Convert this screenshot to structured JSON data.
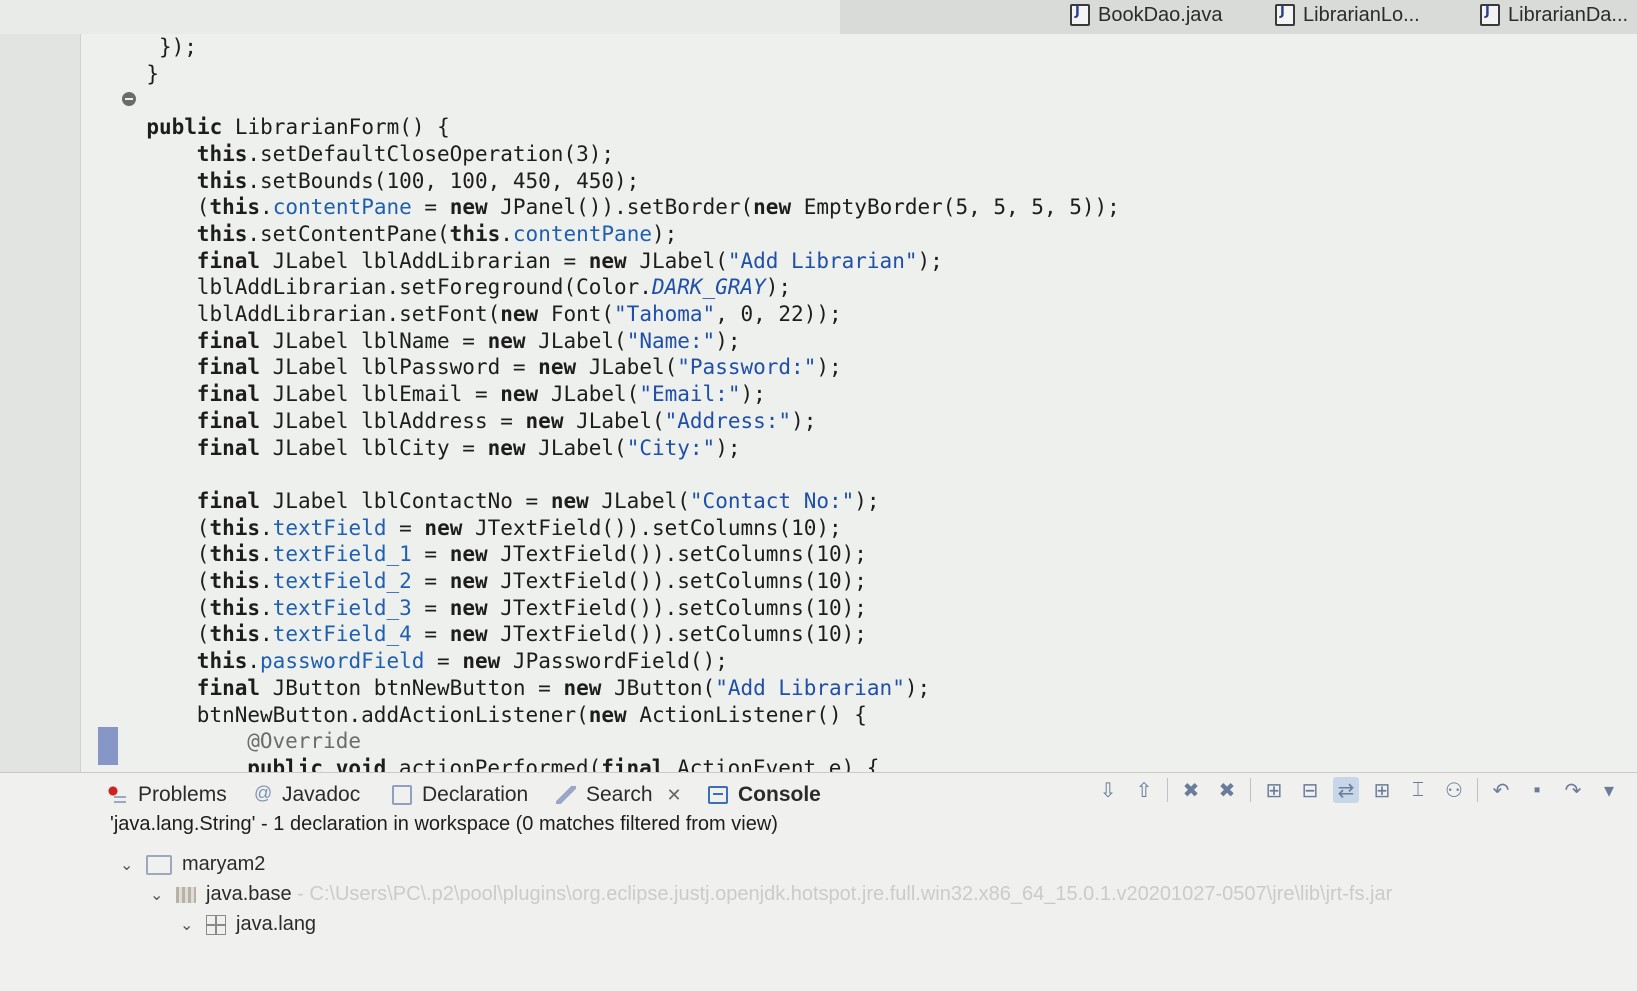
{
  "editor_tabs": [
    {
      "label": "BookDao.java"
    },
    {
      "label": "LibrarianLo..."
    },
    {
      "label": "LibrarianDa..."
    }
  ],
  "code": {
    "lines": [
      {
        "indent": 5,
        "parts": [
          [
            "t",
            "});"
          ]
        ]
      },
      {
        "indent": 4,
        "parts": [
          [
            "t",
            "}"
          ]
        ]
      },
      {
        "indent": 0,
        "parts": []
      },
      {
        "indent": 4,
        "parts": [
          [
            "k",
            "public"
          ],
          [
            "t",
            " LibrarianForm() {"
          ]
        ]
      },
      {
        "indent": 8,
        "parts": [
          [
            "k",
            "this"
          ],
          [
            "t",
            ".setDefaultCloseOperation(3);"
          ]
        ]
      },
      {
        "indent": 8,
        "parts": [
          [
            "k",
            "this"
          ],
          [
            "t",
            ".setBounds(100, 100, 450, 450);"
          ]
        ]
      },
      {
        "indent": 8,
        "parts": [
          [
            "t",
            "("
          ],
          [
            "k",
            "this"
          ],
          [
            "t",
            "."
          ],
          [
            "f",
            "contentPane"
          ],
          [
            "t",
            " = "
          ],
          [
            "k",
            "new"
          ],
          [
            "t",
            " JPanel()).setBorder("
          ],
          [
            "k",
            "new"
          ],
          [
            "t",
            " EmptyBorder(5, 5, 5, 5));"
          ]
        ]
      },
      {
        "indent": 8,
        "parts": [
          [
            "k",
            "this"
          ],
          [
            "t",
            ".setContentPane("
          ],
          [
            "k",
            "this"
          ],
          [
            "t",
            "."
          ],
          [
            "f",
            "contentPane"
          ],
          [
            "t",
            ");"
          ]
        ]
      },
      {
        "indent": 8,
        "parts": [
          [
            "k",
            "final"
          ],
          [
            "t",
            " JLabel lblAddLibrarian = "
          ],
          [
            "k",
            "new"
          ],
          [
            "t",
            " JLabel("
          ],
          [
            "s",
            "\"Add Librarian\""
          ],
          [
            "t",
            ");"
          ]
        ]
      },
      {
        "indent": 8,
        "parts": [
          [
            "t",
            "lblAddLibrarian.setForeground(Color."
          ],
          [
            "c",
            "DARK_GRAY"
          ],
          [
            "t",
            ");"
          ]
        ]
      },
      {
        "indent": 8,
        "parts": [
          [
            "t",
            "lblAddLibrarian.setFont("
          ],
          [
            "k",
            "new"
          ],
          [
            "t",
            " Font("
          ],
          [
            "s",
            "\"Tahoma\""
          ],
          [
            "t",
            ", 0, 22));"
          ]
        ]
      },
      {
        "indent": 8,
        "parts": [
          [
            "k",
            "final"
          ],
          [
            "t",
            " JLabel lblName = "
          ],
          [
            "k",
            "new"
          ],
          [
            "t",
            " JLabel("
          ],
          [
            "s",
            "\"Name:\""
          ],
          [
            "t",
            ");"
          ]
        ]
      },
      {
        "indent": 8,
        "parts": [
          [
            "k",
            "final"
          ],
          [
            "t",
            " JLabel lblPassword = "
          ],
          [
            "k",
            "new"
          ],
          [
            "t",
            " JLabel("
          ],
          [
            "s",
            "\"Password:\""
          ],
          [
            "t",
            ");"
          ]
        ]
      },
      {
        "indent": 8,
        "parts": [
          [
            "k",
            "final"
          ],
          [
            "t",
            " JLabel lblEmail = "
          ],
          [
            "k",
            "new"
          ],
          [
            "t",
            " JLabel("
          ],
          [
            "s",
            "\"Email:\""
          ],
          [
            "t",
            ");"
          ]
        ]
      },
      {
        "indent": 8,
        "parts": [
          [
            "k",
            "final"
          ],
          [
            "t",
            " JLabel lblAddress = "
          ],
          [
            "k",
            "new"
          ],
          [
            "t",
            " JLabel("
          ],
          [
            "s",
            "\"Address:\""
          ],
          [
            "t",
            ");"
          ]
        ]
      },
      {
        "indent": 8,
        "parts": [
          [
            "k",
            "final"
          ],
          [
            "t",
            " JLabel lblCity = "
          ],
          [
            "k",
            "new"
          ],
          [
            "t",
            " JLabel("
          ],
          [
            "s",
            "\"City:\""
          ],
          [
            "t",
            ");"
          ]
        ]
      },
      {
        "indent": 0,
        "parts": []
      },
      {
        "indent": 8,
        "parts": [
          [
            "k",
            "final"
          ],
          [
            "t",
            " JLabel lblContactNo = "
          ],
          [
            "k",
            "new"
          ],
          [
            "t",
            " JLabel("
          ],
          [
            "s",
            "\"Contact No:\""
          ],
          [
            "t",
            ");"
          ]
        ]
      },
      {
        "indent": 8,
        "parts": [
          [
            "t",
            "("
          ],
          [
            "k",
            "this"
          ],
          [
            "t",
            "."
          ],
          [
            "f",
            "textField"
          ],
          [
            "t",
            " = "
          ],
          [
            "k",
            "new"
          ],
          [
            "t",
            " JTextField()).setColumns(10);"
          ]
        ]
      },
      {
        "indent": 8,
        "parts": [
          [
            "t",
            "("
          ],
          [
            "k",
            "this"
          ],
          [
            "t",
            "."
          ],
          [
            "f",
            "textField_1"
          ],
          [
            "t",
            " = "
          ],
          [
            "k",
            "new"
          ],
          [
            "t",
            " JTextField()).setColumns(10);"
          ]
        ]
      },
      {
        "indent": 8,
        "parts": [
          [
            "t",
            "("
          ],
          [
            "k",
            "this"
          ],
          [
            "t",
            "."
          ],
          [
            "f",
            "textField_2"
          ],
          [
            "t",
            " = "
          ],
          [
            "k",
            "new"
          ],
          [
            "t",
            " JTextField()).setColumns(10);"
          ]
        ]
      },
      {
        "indent": 8,
        "parts": [
          [
            "t",
            "("
          ],
          [
            "k",
            "this"
          ],
          [
            "t",
            "."
          ],
          [
            "f",
            "textField_3"
          ],
          [
            "t",
            " = "
          ],
          [
            "k",
            "new"
          ],
          [
            "t",
            " JTextField()).setColumns(10);"
          ]
        ]
      },
      {
        "indent": 8,
        "parts": [
          [
            "t",
            "("
          ],
          [
            "k",
            "this"
          ],
          [
            "t",
            "."
          ],
          [
            "f",
            "textField_4"
          ],
          [
            "t",
            " = "
          ],
          [
            "k",
            "new"
          ],
          [
            "t",
            " JTextField()).setColumns(10);"
          ]
        ]
      },
      {
        "indent": 8,
        "parts": [
          [
            "k",
            "this"
          ],
          [
            "t",
            "."
          ],
          [
            "f",
            "passwordField"
          ],
          [
            "t",
            " = "
          ],
          [
            "k",
            "new"
          ],
          [
            "t",
            " JPasswordField();"
          ]
        ]
      },
      {
        "indent": 8,
        "parts": [
          [
            "k",
            "final"
          ],
          [
            "t",
            " JButton btnNewButton = "
          ],
          [
            "k",
            "new"
          ],
          [
            "t",
            " JButton("
          ],
          [
            "s",
            "\"Add Librarian\""
          ],
          [
            "t",
            ");"
          ]
        ]
      },
      {
        "indent": 8,
        "parts": [
          [
            "t",
            "btnNewButton.addActionListener("
          ],
          [
            "k",
            "new"
          ],
          [
            "t",
            " ActionListener() {"
          ]
        ]
      },
      {
        "indent": 12,
        "parts": [
          [
            "a",
            "@Override"
          ]
        ]
      },
      {
        "indent": 12,
        "parts": [
          [
            "k",
            "public"
          ],
          [
            "t",
            " "
          ],
          [
            "k",
            "void"
          ],
          [
            "t",
            " actionPerformed("
          ],
          [
            "k",
            "final"
          ],
          [
            "t",
            " ActionEvent e) {"
          ]
        ]
      }
    ]
  },
  "hscroll": {
    "left_arrow": "<"
  },
  "bottom_panel": {
    "tabs": [
      {
        "label": "Problems",
        "icon": "problems-icon"
      },
      {
        "label": "Javadoc",
        "icon": "javadoc-icon"
      },
      {
        "label": "Declaration",
        "icon": "declaration-icon"
      },
      {
        "label": "Search",
        "icon": "search-icon",
        "close": "✕"
      },
      {
        "label": "Console",
        "icon": "console-icon",
        "active": true
      }
    ],
    "toolbar_glyphs": [
      "⇩",
      "⇧",
      "✖",
      "✖",
      "⊞",
      "⊟",
      "⇄",
      "⊞",
      "⌶",
      "⚇",
      "↶",
      "▪",
      "↷",
      "▾"
    ],
    "search_summary": "'java.lang.String' - 1 declaration in workspace (0 matches filtered from view)",
    "tree": [
      {
        "label": "maryam2",
        "detail": ""
      },
      {
        "label": "java.base",
        "detail": " - C:\\Users\\PC\\.p2\\pool\\plugins\\org.eclipse.justj.openjdk.hotspot.jre.full.win32.x86_64_15.0.1.v20201027-0507\\jre\\lib\\jrt-fs.jar"
      },
      {
        "label": "java.lang",
        "detail": ""
      }
    ]
  }
}
